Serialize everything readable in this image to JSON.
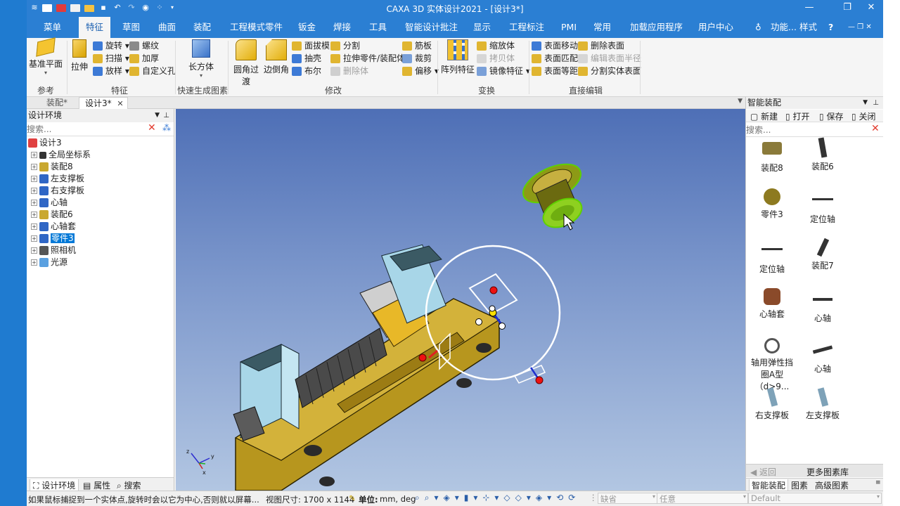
{
  "window": {
    "title": "CAXA 3D 实体设计2021 - [设计3*]",
    "controls": [
      "—",
      "❐",
      "✕"
    ]
  },
  "ribbon_tabs": [
    "菜单",
    "特征",
    "草图",
    "曲面",
    "装配",
    "工程模式零件",
    "钣金",
    "焊接",
    "工具",
    "智能设计批注",
    "显示",
    "工程标注",
    "PMI",
    "常用",
    "加载应用程序",
    "用户中心"
  ],
  "ribbon_right": {
    "search": "功能...",
    "style": "样式",
    "help": "?"
  },
  "ribbon": {
    "ref": {
      "label": "参考",
      "datum_plane": "基准平面"
    },
    "feature": {
      "label": "特征",
      "extrude": "拉伸",
      "revolve": "旋转",
      "sweep": "扫描",
      "loft": "放样",
      "thread": "螺纹",
      "thicken": "加厚",
      "custom_hole": "自定义孔"
    },
    "quick": {
      "label": "快速生成图素",
      "box": "长方体"
    },
    "modify": {
      "label": "修改",
      "fillet": "圆角过渡",
      "chamfer": "边倒角",
      "draft": "面拔模",
      "shell": "抽壳",
      "boolean": "布尔",
      "split": "分割",
      "pull_part": "拉伸零件/装配体",
      "delete_body": "删除体",
      "rib": "筋板",
      "trim": "裁剪",
      "offset": "偏移"
    },
    "transform": {
      "label": "变换",
      "pattern": "阵列特征",
      "scale": "缩放体",
      "copy": "拷贝体",
      "mirror": "镜像特征"
    },
    "direct": {
      "label": "直接编辑",
      "move_face": "表面移动",
      "match_face": "表面匹配",
      "offset_face": "表面等距",
      "delete_face": "删除表面",
      "edit_radius": "编辑表面半径",
      "split_face": "分割实体表面"
    }
  },
  "doc_tabs": [
    {
      "label": "装配*"
    },
    {
      "label": "设计3*",
      "close": "✕"
    }
  ],
  "left_panel": {
    "header": "设计环境",
    "search_placeholder": "搜索...",
    "root": "设计3",
    "items": [
      "全局坐标系",
      "装配8",
      "左支撑板",
      "右支撑板",
      "心轴",
      "装配6",
      "心轴套",
      "零件3",
      "照相机",
      "光源"
    ],
    "selected_index": 7,
    "bottom_tabs": [
      "设计环境",
      "属性",
      "搜索"
    ]
  },
  "right_panel": {
    "header": "智能装配",
    "toolbar": [
      "新建",
      "打开",
      "保存",
      "关闭"
    ],
    "search_placeholder": "搜索...",
    "items": [
      "装配8",
      "装配6",
      "零件3",
      "定位轴",
      "定位轴",
      "装配7",
      "心轴套",
      "心轴",
      "轴用弹性挡圈A型（d>9...",
      "心轴",
      "右支撑板",
      "左支撑板"
    ],
    "back": "返回",
    "more": "更多图素库",
    "bottom_tabs": [
      "智能装配",
      "图素",
      "高级图素"
    ]
  },
  "status": {
    "hint": "如果鼠标捕捉到一个实体点,旋转时会以它为中心,否则就以屏幕...",
    "view_size": "视图尺寸: 1700 x 1144",
    "unit_label": "单位:",
    "unit_value": "mm, deg",
    "combo1": "缺省",
    "combo2": "任意",
    "combo3": "Default"
  },
  "colors": {
    "accent": "#2b7fd3",
    "selection": "#0078d7",
    "part_gold": "#c7a52c"
  }
}
